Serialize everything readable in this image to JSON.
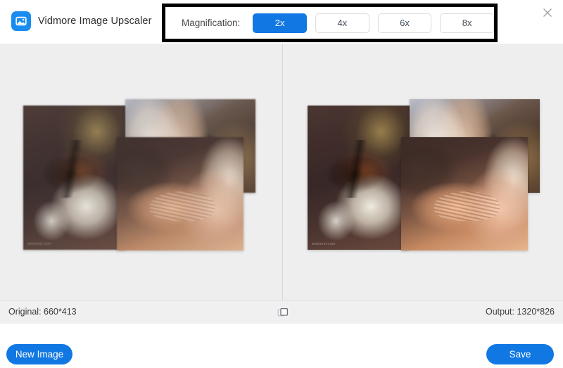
{
  "app": {
    "title": "Vidmore Image Upscaler",
    "logo_icon": "image-photo-icon",
    "close_icon": "close-icon",
    "accent_color": "#1178e3",
    "logo_color": "#1a8cf0",
    "annotation_color": "#000000"
  },
  "magnification": {
    "label": "Magnification:",
    "selected": "2x",
    "options": [
      {
        "label": "2x",
        "active": true
      },
      {
        "label": "4x",
        "active": false
      },
      {
        "label": "6x",
        "active": false
      },
      {
        "label": "8x",
        "active": false
      }
    ]
  },
  "preview": {
    "left_pane_name": "original-preview",
    "right_pane_name": "upscaled-preview",
    "watermark": "webneel.com",
    "tiles": [
      {
        "name": "bicycle-flowers-photo"
      },
      {
        "name": "sun-hat-top-photo"
      },
      {
        "name": "woman-face-closeup-photo"
      }
    ]
  },
  "status": {
    "original": "Original: 660*413",
    "output": "Output: 1320*826",
    "compare_icon": "compare-overlap-icon"
  },
  "footer": {
    "new_image_label": "New Image",
    "save_label": "Save"
  }
}
